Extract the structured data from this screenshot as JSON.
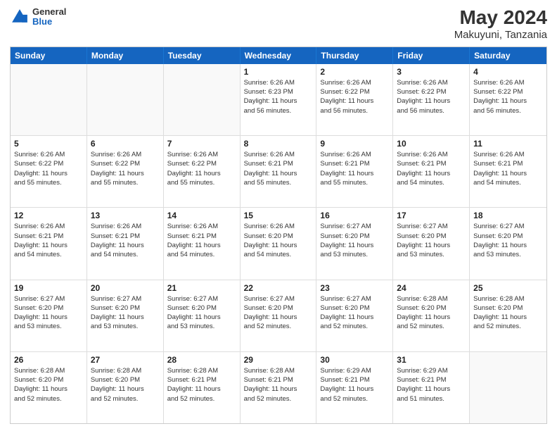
{
  "header": {
    "logo_general": "General",
    "logo_blue": "Blue",
    "month_title": "May 2024",
    "location": "Makuyuni, Tanzania"
  },
  "weekdays": [
    "Sunday",
    "Monday",
    "Tuesday",
    "Wednesday",
    "Thursday",
    "Friday",
    "Saturday"
  ],
  "rows": [
    [
      {
        "day": "",
        "info": ""
      },
      {
        "day": "",
        "info": ""
      },
      {
        "day": "",
        "info": ""
      },
      {
        "day": "1",
        "info": "Sunrise: 6:26 AM\nSunset: 6:23 PM\nDaylight: 11 hours\nand 56 minutes."
      },
      {
        "day": "2",
        "info": "Sunrise: 6:26 AM\nSunset: 6:22 PM\nDaylight: 11 hours\nand 56 minutes."
      },
      {
        "day": "3",
        "info": "Sunrise: 6:26 AM\nSunset: 6:22 PM\nDaylight: 11 hours\nand 56 minutes."
      },
      {
        "day": "4",
        "info": "Sunrise: 6:26 AM\nSunset: 6:22 PM\nDaylight: 11 hours\nand 56 minutes."
      }
    ],
    [
      {
        "day": "5",
        "info": "Sunrise: 6:26 AM\nSunset: 6:22 PM\nDaylight: 11 hours\nand 55 minutes."
      },
      {
        "day": "6",
        "info": "Sunrise: 6:26 AM\nSunset: 6:22 PM\nDaylight: 11 hours\nand 55 minutes."
      },
      {
        "day": "7",
        "info": "Sunrise: 6:26 AM\nSunset: 6:22 PM\nDaylight: 11 hours\nand 55 minutes."
      },
      {
        "day": "8",
        "info": "Sunrise: 6:26 AM\nSunset: 6:21 PM\nDaylight: 11 hours\nand 55 minutes."
      },
      {
        "day": "9",
        "info": "Sunrise: 6:26 AM\nSunset: 6:21 PM\nDaylight: 11 hours\nand 55 minutes."
      },
      {
        "day": "10",
        "info": "Sunrise: 6:26 AM\nSunset: 6:21 PM\nDaylight: 11 hours\nand 54 minutes."
      },
      {
        "day": "11",
        "info": "Sunrise: 6:26 AM\nSunset: 6:21 PM\nDaylight: 11 hours\nand 54 minutes."
      }
    ],
    [
      {
        "day": "12",
        "info": "Sunrise: 6:26 AM\nSunset: 6:21 PM\nDaylight: 11 hours\nand 54 minutes."
      },
      {
        "day": "13",
        "info": "Sunrise: 6:26 AM\nSunset: 6:21 PM\nDaylight: 11 hours\nand 54 minutes."
      },
      {
        "day": "14",
        "info": "Sunrise: 6:26 AM\nSunset: 6:21 PM\nDaylight: 11 hours\nand 54 minutes."
      },
      {
        "day": "15",
        "info": "Sunrise: 6:26 AM\nSunset: 6:20 PM\nDaylight: 11 hours\nand 54 minutes."
      },
      {
        "day": "16",
        "info": "Sunrise: 6:27 AM\nSunset: 6:20 PM\nDaylight: 11 hours\nand 53 minutes."
      },
      {
        "day": "17",
        "info": "Sunrise: 6:27 AM\nSunset: 6:20 PM\nDaylight: 11 hours\nand 53 minutes."
      },
      {
        "day": "18",
        "info": "Sunrise: 6:27 AM\nSunset: 6:20 PM\nDaylight: 11 hours\nand 53 minutes."
      }
    ],
    [
      {
        "day": "19",
        "info": "Sunrise: 6:27 AM\nSunset: 6:20 PM\nDaylight: 11 hours\nand 53 minutes."
      },
      {
        "day": "20",
        "info": "Sunrise: 6:27 AM\nSunset: 6:20 PM\nDaylight: 11 hours\nand 53 minutes."
      },
      {
        "day": "21",
        "info": "Sunrise: 6:27 AM\nSunset: 6:20 PM\nDaylight: 11 hours\nand 53 minutes."
      },
      {
        "day": "22",
        "info": "Sunrise: 6:27 AM\nSunset: 6:20 PM\nDaylight: 11 hours\nand 52 minutes."
      },
      {
        "day": "23",
        "info": "Sunrise: 6:27 AM\nSunset: 6:20 PM\nDaylight: 11 hours\nand 52 minutes."
      },
      {
        "day": "24",
        "info": "Sunrise: 6:28 AM\nSunset: 6:20 PM\nDaylight: 11 hours\nand 52 minutes."
      },
      {
        "day": "25",
        "info": "Sunrise: 6:28 AM\nSunset: 6:20 PM\nDaylight: 11 hours\nand 52 minutes."
      }
    ],
    [
      {
        "day": "26",
        "info": "Sunrise: 6:28 AM\nSunset: 6:20 PM\nDaylight: 11 hours\nand 52 minutes."
      },
      {
        "day": "27",
        "info": "Sunrise: 6:28 AM\nSunset: 6:20 PM\nDaylight: 11 hours\nand 52 minutes."
      },
      {
        "day": "28",
        "info": "Sunrise: 6:28 AM\nSunset: 6:21 PM\nDaylight: 11 hours\nand 52 minutes."
      },
      {
        "day": "29",
        "info": "Sunrise: 6:28 AM\nSunset: 6:21 PM\nDaylight: 11 hours\nand 52 minutes."
      },
      {
        "day": "30",
        "info": "Sunrise: 6:29 AM\nSunset: 6:21 PM\nDaylight: 11 hours\nand 52 minutes."
      },
      {
        "day": "31",
        "info": "Sunrise: 6:29 AM\nSunset: 6:21 PM\nDaylight: 11 hours\nand 51 minutes."
      },
      {
        "day": "",
        "info": ""
      }
    ]
  ]
}
